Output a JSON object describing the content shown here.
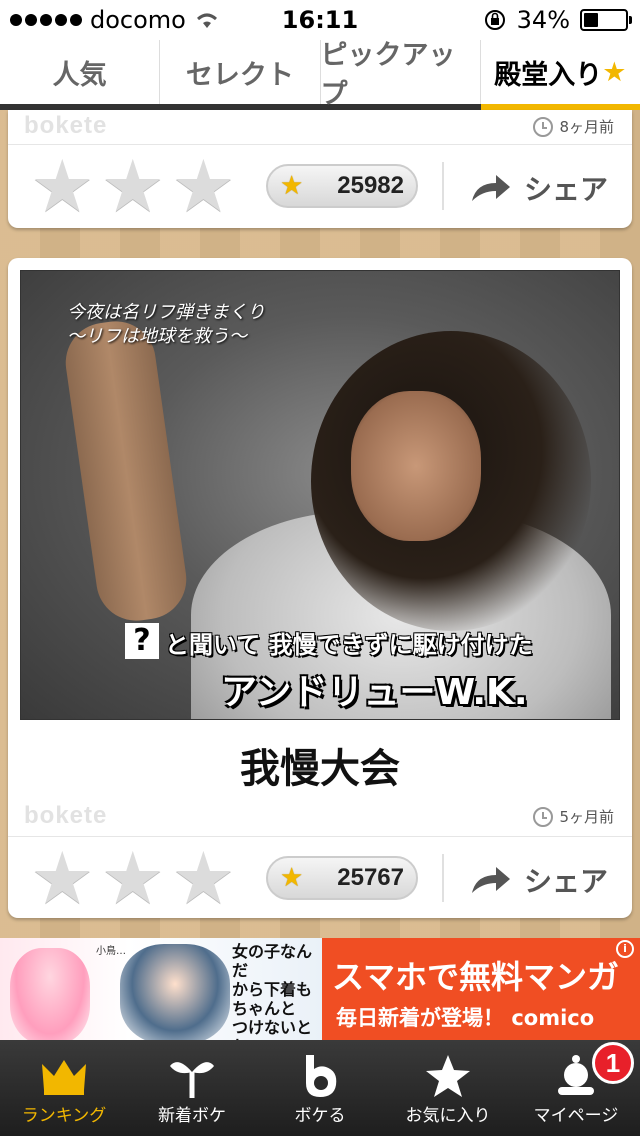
{
  "status_bar": {
    "carrier": "docomo",
    "time": "16:11",
    "battery": "34%"
  },
  "tabs": [
    {
      "label": "人気",
      "active": false
    },
    {
      "label": "セレクト",
      "active": false
    },
    {
      "label": "ピックアップ",
      "active": false
    },
    {
      "label": "殿堂入り",
      "star": "★",
      "active": true
    }
  ],
  "posts": [
    {
      "watermark": "bokete",
      "time_ago": "8ヶ月前",
      "stars": "★★★",
      "count": "25982",
      "share_label": "シェア"
    },
    {
      "image_caption_top_1": "今夜は名リフ弾きまくり",
      "image_caption_top_2": "〜リフは地球を救う〜",
      "image_question_mark": "?",
      "image_caption_bottom_1": "と聞いて 我慢できずに駆け付けた",
      "image_caption_bottom_2": "アンドリューW.K.",
      "title": "我慢大会",
      "watermark": "bokete",
      "time_ago": "5ヶ月前",
      "stars": "★★★",
      "count": "25767",
      "share_label": "シェア"
    }
  ],
  "ad": {
    "manga_small": "小鳥…",
    "manga_text": [
      "女の子なんだ",
      "から下着も",
      "ちゃんと",
      "つけないとね"
    ],
    "line1_part1": "スマホで",
    "line1_part2": "無料マンガ",
    "line2": "毎日新着が登場！",
    "brand": "comico",
    "info": "i"
  },
  "bottom_nav": [
    {
      "label": "ランキング",
      "icon": "crown-icon",
      "active": true
    },
    {
      "label": "新着ボケ",
      "icon": "sprout-icon",
      "active": false
    },
    {
      "label": "ボケる",
      "icon": "bokete-b-icon",
      "active": false
    },
    {
      "label": "お気に入り",
      "icon": "star-icon",
      "active": false
    },
    {
      "label": "マイページ",
      "icon": "profile-icon",
      "active": false,
      "badge": "1"
    }
  ],
  "colors": {
    "accent": "#f2b700",
    "ad_orange": "#f04e23",
    "badge_red": "#e8202a"
  }
}
